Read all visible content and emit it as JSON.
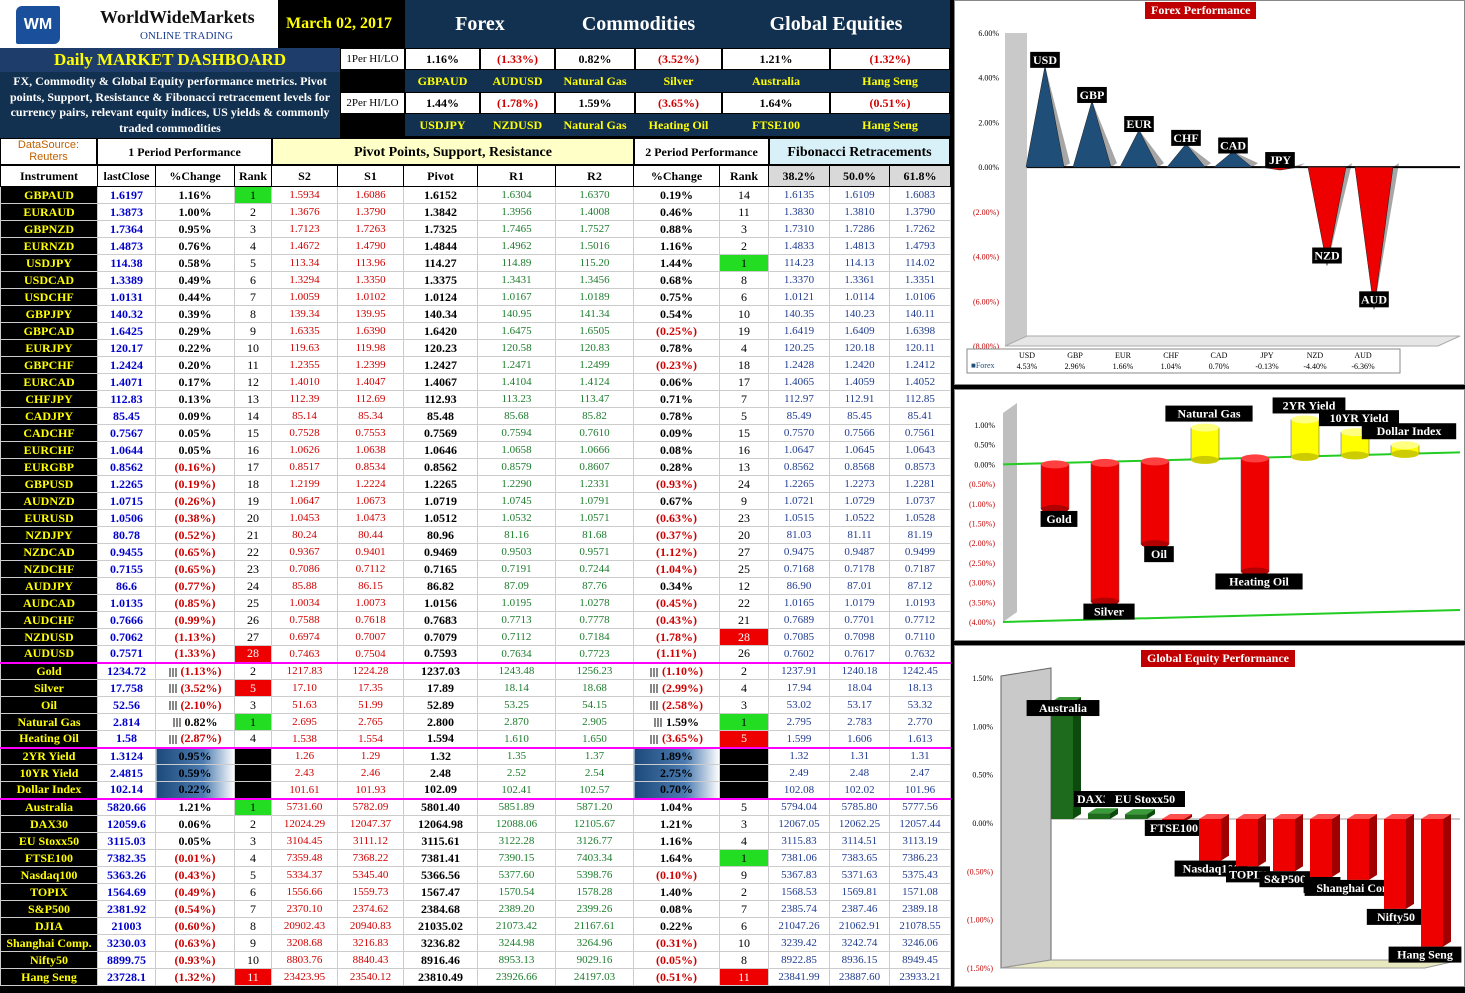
{
  "header": {
    "brand": "WorldWideMarkets",
    "subbrand": "ONLINE TRADING",
    "logo": "WM",
    "date": "March 02, 2017",
    "categories": [
      "Forex",
      "Commodities",
      "Global Equities"
    ],
    "title": "Daily MARKET DASHBOARD",
    "description": "FX, Commodity & Global Equity performance metrics. Pivot points, Support, Resistance & Fibonacci retracement levels for currency pairs, relevant equity indices, US yields & commonly traded commodities"
  },
  "period1": {
    "label": "1Per HI/LO",
    "values": [
      "1.16%",
      "(1.33%)",
      "0.82%",
      "(3.52%)",
      "1.21%",
      "(1.32%)"
    ],
    "instruments": [
      "GBPAUD",
      "AUDUSD",
      "Natural Gas",
      "Silver",
      "Australia",
      "Hang Seng"
    ]
  },
  "period2": {
    "label": "2Per HI/LO",
    "values": [
      "1.44%",
      "(1.78%)",
      "1.59%",
      "(3.65%)",
      "1.64%",
      "(0.51%)"
    ],
    "instruments": [
      "USDJPY",
      "NZDUSD",
      "Natural Gas",
      "Heating Oil",
      "FTSE100",
      "Hang Seng"
    ]
  },
  "sections": {
    "source": "DataSource: Reuters",
    "p1": "1 Period Performance",
    "pivot": "Pivot Points, Support, Resistance",
    "p2": "2 Period Performance",
    "fib": "Fibonacci Retracements"
  },
  "columns": [
    "Instrument",
    "lastClose",
    "%Change",
    "Rank",
    "S2",
    "S1",
    "Pivot",
    "R1",
    "R2",
    "%Change",
    "Rank",
    "38.2%",
    "50.0%",
    "61.8%"
  ],
  "rows": [
    [
      "GBPAUD",
      "1.6197",
      "1.16%",
      "1",
      "1.5934",
      "1.6086",
      "1.6152",
      "1.6304",
      "1.6370",
      "0.19%",
      "14",
      "1.6135",
      "1.6109",
      "1.6083"
    ],
    [
      "EURAUD",
      "1.3873",
      "1.00%",
      "2",
      "1.3676",
      "1.3790",
      "1.3842",
      "1.3956",
      "1.4008",
      "0.46%",
      "11",
      "1.3830",
      "1.3810",
      "1.3790"
    ],
    [
      "GBPNZD",
      "1.7364",
      "0.95%",
      "3",
      "1.7123",
      "1.7263",
      "1.7325",
      "1.7465",
      "1.7527",
      "0.88%",
      "3",
      "1.7310",
      "1.7286",
      "1.7262"
    ],
    [
      "EURNZD",
      "1.4873",
      "0.76%",
      "4",
      "1.4672",
      "1.4790",
      "1.4844",
      "1.4962",
      "1.5016",
      "1.16%",
      "2",
      "1.4833",
      "1.4813",
      "1.4793"
    ],
    [
      "USDJPY",
      "114.38",
      "0.58%",
      "5",
      "113.34",
      "113.96",
      "114.27",
      "114.89",
      "115.20",
      "1.44%",
      "1",
      "114.23",
      "114.13",
      "114.02"
    ],
    [
      "USDCAD",
      "1.3389",
      "0.49%",
      "6",
      "1.3294",
      "1.3350",
      "1.3375",
      "1.3431",
      "1.3456",
      "0.68%",
      "8",
      "1.3370",
      "1.3361",
      "1.3351"
    ],
    [
      "USDCHF",
      "1.0131",
      "0.44%",
      "7",
      "1.0059",
      "1.0102",
      "1.0124",
      "1.0167",
      "1.0189",
      "0.75%",
      "6",
      "1.0121",
      "1.0114",
      "1.0106"
    ],
    [
      "GBPJPY",
      "140.32",
      "0.39%",
      "8",
      "139.34",
      "139.95",
      "140.34",
      "140.95",
      "141.34",
      "0.54%",
      "10",
      "140.35",
      "140.23",
      "140.11"
    ],
    [
      "GBPCAD",
      "1.6425",
      "0.29%",
      "9",
      "1.6335",
      "1.6390",
      "1.6420",
      "1.6475",
      "1.6505",
      "(0.25%)",
      "19",
      "1.6419",
      "1.6409",
      "1.6398"
    ],
    [
      "EURJPY",
      "120.17",
      "0.22%",
      "10",
      "119.63",
      "119.98",
      "120.23",
      "120.58",
      "120.83",
      "0.78%",
      "4",
      "120.25",
      "120.18",
      "120.11"
    ],
    [
      "GBPCHF",
      "1.2424",
      "0.20%",
      "11",
      "1.2355",
      "1.2399",
      "1.2427",
      "1.2471",
      "1.2499",
      "(0.23%)",
      "18",
      "1.2428",
      "1.2420",
      "1.2412"
    ],
    [
      "EURCAD",
      "1.4071",
      "0.17%",
      "12",
      "1.4010",
      "1.4047",
      "1.4067",
      "1.4104",
      "1.4124",
      "0.06%",
      "17",
      "1.4065",
      "1.4059",
      "1.4052"
    ],
    [
      "CHFJPY",
      "112.83",
      "0.13%",
      "13",
      "112.39",
      "112.69",
      "112.93",
      "113.23",
      "113.47",
      "0.71%",
      "7",
      "112.97",
      "112.91",
      "112.85"
    ],
    [
      "CADJPY",
      "85.45",
      "0.09%",
      "14",
      "85.14",
      "85.34",
      "85.48",
      "85.68",
      "85.82",
      "0.78%",
      "5",
      "85.49",
      "85.45",
      "85.41"
    ],
    [
      "CADCHF",
      "0.7567",
      "0.05%",
      "15",
      "0.7528",
      "0.7553",
      "0.7569",
      "0.7594",
      "0.7610",
      "0.09%",
      "15",
      "0.7570",
      "0.7566",
      "0.7561"
    ],
    [
      "EURCHF",
      "1.0644",
      "0.05%",
      "16",
      "1.0626",
      "1.0638",
      "1.0646",
      "1.0658",
      "1.0666",
      "0.08%",
      "16",
      "1.0647",
      "1.0645",
      "1.0643"
    ],
    [
      "EURGBP",
      "0.8562",
      "(0.16%)",
      "17",
      "0.8517",
      "0.8534",
      "0.8562",
      "0.8579",
      "0.8607",
      "0.28%",
      "13",
      "0.8562",
      "0.8568",
      "0.8573"
    ],
    [
      "GBPUSD",
      "1.2265",
      "(0.19%)",
      "18",
      "1.2199",
      "1.2224",
      "1.2265",
      "1.2290",
      "1.2331",
      "(0.93%)",
      "24",
      "1.2265",
      "1.2273",
      "1.2281"
    ],
    [
      "AUDNZD",
      "1.0715",
      "(0.26%)",
      "19",
      "1.0647",
      "1.0673",
      "1.0719",
      "1.0745",
      "1.0791",
      "0.67%",
      "9",
      "1.0721",
      "1.0729",
      "1.0737"
    ],
    [
      "EURUSD",
      "1.0506",
      "(0.38%)",
      "20",
      "1.0453",
      "1.0473",
      "1.0512",
      "1.0532",
      "1.0571",
      "(0.63%)",
      "23",
      "1.0515",
      "1.0522",
      "1.0528"
    ],
    [
      "NZDJPY",
      "80.78",
      "(0.52%)",
      "21",
      "80.24",
      "80.44",
      "80.96",
      "81.16",
      "81.68",
      "(0.37%)",
      "20",
      "81.03",
      "81.11",
      "81.19"
    ],
    [
      "NZDCAD",
      "0.9455",
      "(0.65%)",
      "22",
      "0.9367",
      "0.9401",
      "0.9469",
      "0.9503",
      "0.9571",
      "(1.12%)",
      "27",
      "0.9475",
      "0.9487",
      "0.9499"
    ],
    [
      "NZDCHF",
      "0.7155",
      "(0.65%)",
      "23",
      "0.7086",
      "0.7112",
      "0.7165",
      "0.7191",
      "0.7244",
      "(1.04%)",
      "25",
      "0.7168",
      "0.7178",
      "0.7187"
    ],
    [
      "AUDJPY",
      "86.6",
      "(0.77%)",
      "24",
      "85.88",
      "86.15",
      "86.82",
      "87.09",
      "87.76",
      "0.34%",
      "12",
      "86.90",
      "87.01",
      "87.12"
    ],
    [
      "AUDCAD",
      "1.0135",
      "(0.85%)",
      "25",
      "1.0034",
      "1.0073",
      "1.0156",
      "1.0195",
      "1.0278",
      "(0.45%)",
      "22",
      "1.0165",
      "1.0179",
      "1.0193"
    ],
    [
      "AUDCHF",
      "0.7666",
      "(0.99%)",
      "26",
      "0.7588",
      "0.7618",
      "0.7683",
      "0.7713",
      "0.7778",
      "(0.43%)",
      "21",
      "0.7689",
      "0.7701",
      "0.7712"
    ],
    [
      "NZDUSD",
      "0.7062",
      "(1.13%)",
      "27",
      "0.6974",
      "0.7007",
      "0.7079",
      "0.7112",
      "0.7184",
      "(1.78%)",
      "28",
      "0.7085",
      "0.7098",
      "0.7110"
    ],
    [
      "AUDUSD",
      "0.7571",
      "(1.33%)",
      "28",
      "0.7463",
      "0.7504",
      "0.7593",
      "0.7634",
      "0.7723",
      "(1.11%)",
      "26",
      "0.7602",
      "0.7617",
      "0.7632"
    ],
    [
      "Gold",
      "1234.72",
      "(1.13%)",
      "2",
      "1217.83",
      "1224.28",
      "1237.03",
      "1243.48",
      "1256.23",
      "(1.10%)",
      "2",
      "1237.91",
      "1240.18",
      "1242.45"
    ],
    [
      "Silver",
      "17.758",
      "(3.52%)",
      "5",
      "17.10",
      "17.35",
      "17.89",
      "18.14",
      "18.68",
      "(2.99%)",
      "4",
      "17.94",
      "18.04",
      "18.13"
    ],
    [
      "Oil",
      "52.56",
      "(2.10%)",
      "3",
      "51.63",
      "51.99",
      "52.89",
      "53.25",
      "54.15",
      "(2.58%)",
      "3",
      "53.02",
      "53.17",
      "53.32"
    ],
    [
      "Natural Gas",
      "2.814",
      "0.82%",
      "1",
      "2.695",
      "2.765",
      "2.800",
      "2.870",
      "2.905",
      "1.59%",
      "1",
      "2.795",
      "2.783",
      "2.770"
    ],
    [
      "Heating Oil",
      "1.58",
      "(2.87%)",
      "4",
      "1.538",
      "1.554",
      "1.594",
      "1.610",
      "1.650",
      "(3.65%)",
      "5",
      "1.599",
      "1.606",
      "1.613"
    ],
    [
      "2YR Yield",
      "1.3124",
      "0.95%",
      "",
      "1.26",
      "1.29",
      "1.32",
      "1.35",
      "1.37",
      "1.89%",
      "",
      "1.32",
      "1.31",
      "1.31"
    ],
    [
      "10YR Yield",
      "2.4815",
      "0.59%",
      "",
      "2.43",
      "2.46",
      "2.48",
      "2.52",
      "2.54",
      "2.75%",
      "",
      "2.49",
      "2.48",
      "2.47"
    ],
    [
      "Dollar Index",
      "102.14",
      "0.22%",
      "",
      "101.61",
      "101.93",
      "102.09",
      "102.41",
      "102.57",
      "0.70%",
      "",
      "102.08",
      "102.02",
      "101.96"
    ],
    [
      "Australia",
      "5820.66",
      "1.21%",
      "1",
      "5731.60",
      "5782.09",
      "5801.40",
      "5851.89",
      "5871.20",
      "1.04%",
      "5",
      "5794.04",
      "5785.80",
      "5777.56"
    ],
    [
      "DAX30",
      "12059.6",
      "0.06%",
      "2",
      "12024.29",
      "12047.37",
      "12064.98",
      "12088.06",
      "12105.67",
      "1.21%",
      "3",
      "12067.05",
      "12062.25",
      "12057.44"
    ],
    [
      "EU Stoxx50",
      "3115.03",
      "0.05%",
      "3",
      "3104.45",
      "3111.12",
      "3115.61",
      "3122.28",
      "3126.77",
      "1.16%",
      "4",
      "3115.83",
      "3114.51",
      "3113.19"
    ],
    [
      "FTSE100",
      "7382.35",
      "(0.01%)",
      "4",
      "7359.48",
      "7368.22",
      "7381.41",
      "7390.15",
      "7403.34",
      "1.64%",
      "1",
      "7381.06",
      "7383.65",
      "7386.23"
    ],
    [
      "Nasdaq100",
      "5363.26",
      "(0.43%)",
      "5",
      "5334.37",
      "5345.40",
      "5366.56",
      "5377.60",
      "5398.76",
      "(0.10%)",
      "9",
      "5367.83",
      "5371.63",
      "5375.43"
    ],
    [
      "TOPIX",
      "1564.69",
      "(0.49%)",
      "6",
      "1556.66",
      "1559.73",
      "1567.47",
      "1570.54",
      "1578.28",
      "1.40%",
      "2",
      "1568.53",
      "1569.81",
      "1571.08"
    ],
    [
      "S&P500",
      "2381.92",
      "(0.54%)",
      "7",
      "2370.10",
      "2374.62",
      "2384.68",
      "2389.20",
      "2399.26",
      "0.08%",
      "7",
      "2385.74",
      "2387.46",
      "2389.18"
    ],
    [
      "DJIA",
      "21003",
      "(0.60%)",
      "8",
      "20902.43",
      "20940.83",
      "21035.02",
      "21073.42",
      "21167.61",
      "0.22%",
      "6",
      "21047.26",
      "21062.91",
      "21078.55"
    ],
    [
      "Shanghai Comp.",
      "3230.03",
      "(0.63%)",
      "9",
      "3208.68",
      "3216.83",
      "3236.82",
      "3244.98",
      "3264.96",
      "(0.31%)",
      "10",
      "3239.42",
      "3242.74",
      "3246.06"
    ],
    [
      "Nifty50",
      "8899.75",
      "(0.93%)",
      "10",
      "8803.76",
      "8840.43",
      "8916.46",
      "8953.13",
      "9029.16",
      "(0.05%)",
      "8",
      "8922.85",
      "8936.15",
      "8949.45"
    ],
    [
      "Hang Seng",
      "23728.1",
      "(1.32%)",
      "11",
      "23423.95",
      "23540.12",
      "23810.49",
      "23926.66",
      "24197.03",
      "(0.51%)",
      "11",
      "23841.99",
      "23887.60",
      "23933.21"
    ]
  ],
  "colors": {
    "navy": "#12304f",
    "yellow": "#ffff00",
    "up": "#1f4e79",
    "down": "#ee0000",
    "green": "#22dd22"
  },
  "chart_data": [
    {
      "type": "bar",
      "title": "Forex  Performance",
      "categories": [
        "USD",
        "GBP",
        "EUR",
        "CHF",
        "CAD",
        "JPY",
        "NZD",
        "AUD"
      ],
      "series": [
        {
          "name": "Forex",
          "values": [
            4.53,
            2.96,
            1.66,
            1.04,
            0.7,
            -0.13,
            -4.4,
            -6.36
          ]
        }
      ],
      "value_labels": [
        "4.53%",
        "2.96%",
        "1.66%",
        "1.04%",
        "0.70%",
        "-0.13%",
        "-4.40%",
        "-6.36%"
      ],
      "ylim": [
        -8,
        6
      ],
      "yticks": [
        "6.00%",
        "4.00%",
        "2.00%",
        "0.00%",
        "(2.00%)",
        "(4.00%)",
        "(6.00%)",
        "(8.00%)"
      ]
    },
    {
      "type": "bar",
      "title": "",
      "categories": [
        "Gold",
        "Silver",
        "Oil",
        "Natural Gas",
        "Heating Oil",
        "2YR Yield",
        "10YR Yield",
        "Dollar Index"
      ],
      "values": [
        -1.13,
        -3.52,
        -2.1,
        0.82,
        -2.87,
        0.95,
        0.59,
        0.22
      ],
      "ylim": [
        -4,
        1
      ],
      "yticks": [
        "1.00%",
        "0.50%",
        "0.00%",
        "(0.50%)",
        "(1.00%)",
        "(1.50%)",
        "(2.00%)",
        "(2.50%)",
        "(3.00%)",
        "(3.50%)",
        "(4.00%)"
      ]
    },
    {
      "type": "bar",
      "title": "Global Equity Performance",
      "categories": [
        "Australia",
        "DAX30",
        "EU Stoxx50",
        "FTSE100",
        "Nasdaq100",
        "TOPIX",
        "S&P500",
        "DJIA",
        "Shanghai Comp.",
        "Nifty50",
        "Hang Seng"
      ],
      "values": [
        1.21,
        0.06,
        0.05,
        -0.01,
        -0.43,
        -0.49,
        -0.54,
        -0.6,
        -0.63,
        -0.93,
        -1.32
      ],
      "ylim": [
        -1.5,
        1.5
      ],
      "yticks": [
        "1.50%",
        "1.00%",
        "0.50%",
        "0.00%",
        "(0.50%)",
        "(1.00%)",
        "(1.50%)"
      ]
    }
  ]
}
